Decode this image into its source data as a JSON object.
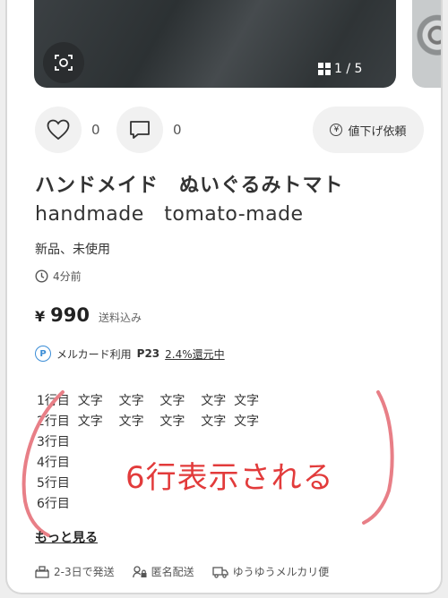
{
  "gallery": {
    "counter": "1 / 5",
    "icons": [
      "scan-icon",
      "grid-icon"
    ]
  },
  "actions": {
    "like_count": "0",
    "comment_count": "0",
    "price_request_label": "値下げ依頼"
  },
  "item": {
    "title_line1": "ハンドメイド　ぬいぐるみトマト",
    "title_line2": "handmade　tomato-made",
    "condition": "新品、未使用",
    "posted": "4分前",
    "currency": "¥",
    "price": "990",
    "shipping_note": "送料込み"
  },
  "points": {
    "label": "メルカード利用",
    "points": "P23",
    "rate": "2.4%還元中"
  },
  "description": [
    "1行目  文字    文字    文字    文字  文字",
    "2行目  文字    文字    文字    文字  文字",
    "3行目",
    "4行目",
    "5行目",
    "6行目"
  ],
  "annotation": {
    "text": "6行表示される",
    "color": "#e23b3b",
    "bracket_color": "#e87f87"
  },
  "more_label": "もっと見る",
  "shipping": {
    "days": "2-3日で発送",
    "anonymous": "匿名配送",
    "method": "ゆうゆうメルカリ便"
  }
}
